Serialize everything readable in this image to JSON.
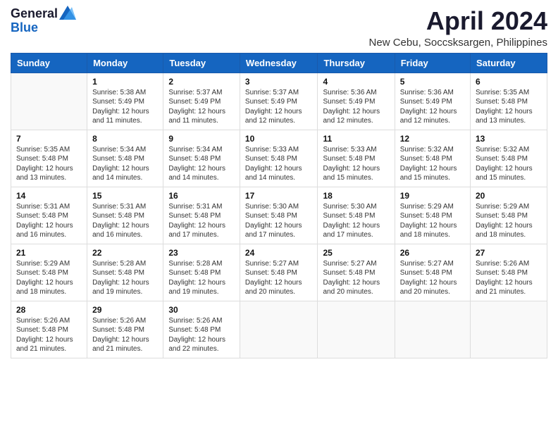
{
  "header": {
    "logo_general": "General",
    "logo_blue": "Blue",
    "title": "April 2024",
    "subtitle": "New Cebu, Soccsksargen, Philippines"
  },
  "days_of_week": [
    "Sunday",
    "Monday",
    "Tuesday",
    "Wednesday",
    "Thursday",
    "Friday",
    "Saturday"
  ],
  "weeks": [
    [
      {
        "day": "",
        "info": ""
      },
      {
        "day": "1",
        "info": "Sunrise: 5:38 AM\nSunset: 5:49 PM\nDaylight: 12 hours and 11 minutes."
      },
      {
        "day": "2",
        "info": "Sunrise: 5:37 AM\nSunset: 5:49 PM\nDaylight: 12 hours and 11 minutes."
      },
      {
        "day": "3",
        "info": "Sunrise: 5:37 AM\nSunset: 5:49 PM\nDaylight: 12 hours and 12 minutes."
      },
      {
        "day": "4",
        "info": "Sunrise: 5:36 AM\nSunset: 5:49 PM\nDaylight: 12 hours and 12 minutes."
      },
      {
        "day": "5",
        "info": "Sunrise: 5:36 AM\nSunset: 5:49 PM\nDaylight: 12 hours and 12 minutes."
      },
      {
        "day": "6",
        "info": "Sunrise: 5:35 AM\nSunset: 5:48 PM\nDaylight: 12 hours and 13 minutes."
      }
    ],
    [
      {
        "day": "7",
        "info": "Sunrise: 5:35 AM\nSunset: 5:48 PM\nDaylight: 12 hours and 13 minutes."
      },
      {
        "day": "8",
        "info": "Sunrise: 5:34 AM\nSunset: 5:48 PM\nDaylight: 12 hours and 14 minutes."
      },
      {
        "day": "9",
        "info": "Sunrise: 5:34 AM\nSunset: 5:48 PM\nDaylight: 12 hours and 14 minutes."
      },
      {
        "day": "10",
        "info": "Sunrise: 5:33 AM\nSunset: 5:48 PM\nDaylight: 12 hours and 14 minutes."
      },
      {
        "day": "11",
        "info": "Sunrise: 5:33 AM\nSunset: 5:48 PM\nDaylight: 12 hours and 15 minutes."
      },
      {
        "day": "12",
        "info": "Sunrise: 5:32 AM\nSunset: 5:48 PM\nDaylight: 12 hours and 15 minutes."
      },
      {
        "day": "13",
        "info": "Sunrise: 5:32 AM\nSunset: 5:48 PM\nDaylight: 12 hours and 15 minutes."
      }
    ],
    [
      {
        "day": "14",
        "info": "Sunrise: 5:31 AM\nSunset: 5:48 PM\nDaylight: 12 hours and 16 minutes."
      },
      {
        "day": "15",
        "info": "Sunrise: 5:31 AM\nSunset: 5:48 PM\nDaylight: 12 hours and 16 minutes."
      },
      {
        "day": "16",
        "info": "Sunrise: 5:31 AM\nSunset: 5:48 PM\nDaylight: 12 hours and 17 minutes."
      },
      {
        "day": "17",
        "info": "Sunrise: 5:30 AM\nSunset: 5:48 PM\nDaylight: 12 hours and 17 minutes."
      },
      {
        "day": "18",
        "info": "Sunrise: 5:30 AM\nSunset: 5:48 PM\nDaylight: 12 hours and 17 minutes."
      },
      {
        "day": "19",
        "info": "Sunrise: 5:29 AM\nSunset: 5:48 PM\nDaylight: 12 hours and 18 minutes."
      },
      {
        "day": "20",
        "info": "Sunrise: 5:29 AM\nSunset: 5:48 PM\nDaylight: 12 hours and 18 minutes."
      }
    ],
    [
      {
        "day": "21",
        "info": "Sunrise: 5:29 AM\nSunset: 5:48 PM\nDaylight: 12 hours and 18 minutes."
      },
      {
        "day": "22",
        "info": "Sunrise: 5:28 AM\nSunset: 5:48 PM\nDaylight: 12 hours and 19 minutes."
      },
      {
        "day": "23",
        "info": "Sunrise: 5:28 AM\nSunset: 5:48 PM\nDaylight: 12 hours and 19 minutes."
      },
      {
        "day": "24",
        "info": "Sunrise: 5:27 AM\nSunset: 5:48 PM\nDaylight: 12 hours and 20 minutes."
      },
      {
        "day": "25",
        "info": "Sunrise: 5:27 AM\nSunset: 5:48 PM\nDaylight: 12 hours and 20 minutes."
      },
      {
        "day": "26",
        "info": "Sunrise: 5:27 AM\nSunset: 5:48 PM\nDaylight: 12 hours and 20 minutes."
      },
      {
        "day": "27",
        "info": "Sunrise: 5:26 AM\nSunset: 5:48 PM\nDaylight: 12 hours and 21 minutes."
      }
    ],
    [
      {
        "day": "28",
        "info": "Sunrise: 5:26 AM\nSunset: 5:48 PM\nDaylight: 12 hours and 21 minutes."
      },
      {
        "day": "29",
        "info": "Sunrise: 5:26 AM\nSunset: 5:48 PM\nDaylight: 12 hours and 21 minutes."
      },
      {
        "day": "30",
        "info": "Sunrise: 5:26 AM\nSunset: 5:48 PM\nDaylight: 12 hours and 22 minutes."
      },
      {
        "day": "",
        "info": ""
      },
      {
        "day": "",
        "info": ""
      },
      {
        "day": "",
        "info": ""
      },
      {
        "day": "",
        "info": ""
      }
    ]
  ]
}
